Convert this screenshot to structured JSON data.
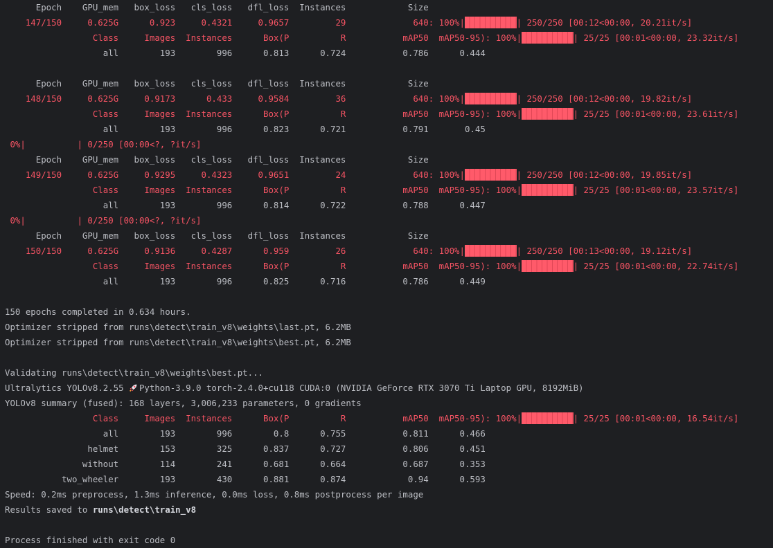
{
  "terminal": {
    "train_headers": [
      "Epoch",
      "GPU_mem",
      "box_loss",
      "cls_loss",
      "dfl_loss",
      "Instances",
      "Size"
    ],
    "val_headers": [
      "Class",
      "Images",
      "Instances",
      "Box(P",
      "R",
      "mAP50",
      "mAP50-95):"
    ],
    "epochs": [
      {
        "idle_before": false,
        "epoch": "147/150",
        "gpu_mem": "0.625G",
        "box_loss": "0.923",
        "cls_loss": "0.4321",
        "dfl_loss": "0.9657",
        "instances": "29",
        "size": "640",
        "train_pct": "100%",
        "train_fraction": 1.0,
        "train_count": "250/250",
        "train_timing": "[00:12<00:00, 20.21it/s]",
        "val_pct": "100%",
        "val_fraction": 1.0,
        "val_count": "25/25",
        "val_timing": "[00:01<00:00, 23.32it/s]",
        "metrics": [
          "all",
          "193",
          "996",
          "0.813",
          "0.724",
          "0.786",
          "0.444"
        ]
      },
      {
        "idle_before": false,
        "epoch": "148/150",
        "gpu_mem": "0.625G",
        "box_loss": "0.9173",
        "cls_loss": "0.433",
        "dfl_loss": "0.9584",
        "instances": "36",
        "size": "640",
        "train_pct": "100%",
        "train_fraction": 1.0,
        "train_count": "250/250",
        "train_timing": "[00:12<00:00, 19.82it/s]",
        "val_pct": "100%",
        "val_fraction": 1.0,
        "val_count": "25/25",
        "val_timing": "[00:01<00:00, 23.61it/s]",
        "metrics": [
          "all",
          "193",
          "996",
          "0.823",
          "0.721",
          "0.791",
          "0.45"
        ]
      },
      {
        "idle_before": true,
        "epoch": "149/150",
        "gpu_mem": "0.625G",
        "box_loss": "0.9295",
        "cls_loss": "0.4323",
        "dfl_loss": "0.9651",
        "instances": "24",
        "size": "640",
        "train_pct": "100%",
        "train_fraction": 1.0,
        "train_count": "250/250",
        "train_timing": "[00:12<00:00, 19.85it/s]",
        "val_pct": "100%",
        "val_fraction": 1.0,
        "val_count": "25/25",
        "val_timing": "[00:01<00:00, 23.57it/s]",
        "metrics": [
          "all",
          "193",
          "996",
          "0.814",
          "0.722",
          "0.788",
          "0.447"
        ]
      },
      {
        "idle_before": true,
        "epoch": "150/150",
        "gpu_mem": "0.625G",
        "box_loss": "0.9136",
        "cls_loss": "0.4287",
        "dfl_loss": "0.959",
        "instances": "26",
        "size": "640",
        "train_pct": "100%",
        "train_fraction": 1.0,
        "train_count": "250/250",
        "train_timing": "[00:13<00:00, 19.12it/s]",
        "val_pct": "100%",
        "val_fraction": 1.0,
        "val_count": "25/25",
        "val_timing": "[00:01<00:00, 22.74it/s]",
        "metrics": [
          "all",
          "193",
          "996",
          "0.825",
          "0.716",
          "0.786",
          "0.449"
        ]
      }
    ],
    "idle_progress": {
      "pct": "0%",
      "fraction": 0,
      "count": "0/250",
      "timing": "[00:00<?, ?it/s]"
    },
    "completed": "150 epochs completed in 0.634 hours.",
    "optimizer_lines": [
      "Optimizer stripped from runs\\detect\\train_v8\\weights\\last.pt, 6.2MB",
      "Optimizer stripped from runs\\detect\\train_v8\\weights\\best.pt, 6.2MB"
    ],
    "validating": "Validating runs\\detect\\train_v8\\weights\\best.pt...",
    "version_prefix": "Ultralytics YOLOv8.2.55 ",
    "version_suffix": " Python-3.9.0 torch-2.4.0+cu118 CUDA:0 (NVIDIA GeForce RTX 3070 Ti Laptop GPU, 8192MiB)",
    "summary": "YOLOv8 summary (fused): 168 layers, 3,006,233 parameters, 0 gradients",
    "final_val": {
      "pct": "100%",
      "fraction": 1.0,
      "count": "25/25",
      "timing": "[00:01<00:00, 16.54it/s]"
    },
    "final_metrics": [
      [
        "all",
        "193",
        "996",
        "0.8",
        "0.755",
        "0.811",
        "0.466"
      ],
      [
        "helmet",
        "153",
        "325",
        "0.837",
        "0.727",
        "0.806",
        "0.451"
      ],
      [
        "without",
        "114",
        "241",
        "0.681",
        "0.664",
        "0.687",
        "0.353"
      ],
      [
        "two_wheeler",
        "193",
        "430",
        "0.881",
        "0.874",
        "0.94",
        "0.593"
      ]
    ],
    "speed": "Speed: 0.2ms preprocess, 1.3ms inference, 0.0ms loss, 0.8ms postprocess per image",
    "results_prefix": "Results saved to ",
    "results_path": "runs\\detect\\train_v8",
    "exit": "Process finished with exit code 0"
  }
}
